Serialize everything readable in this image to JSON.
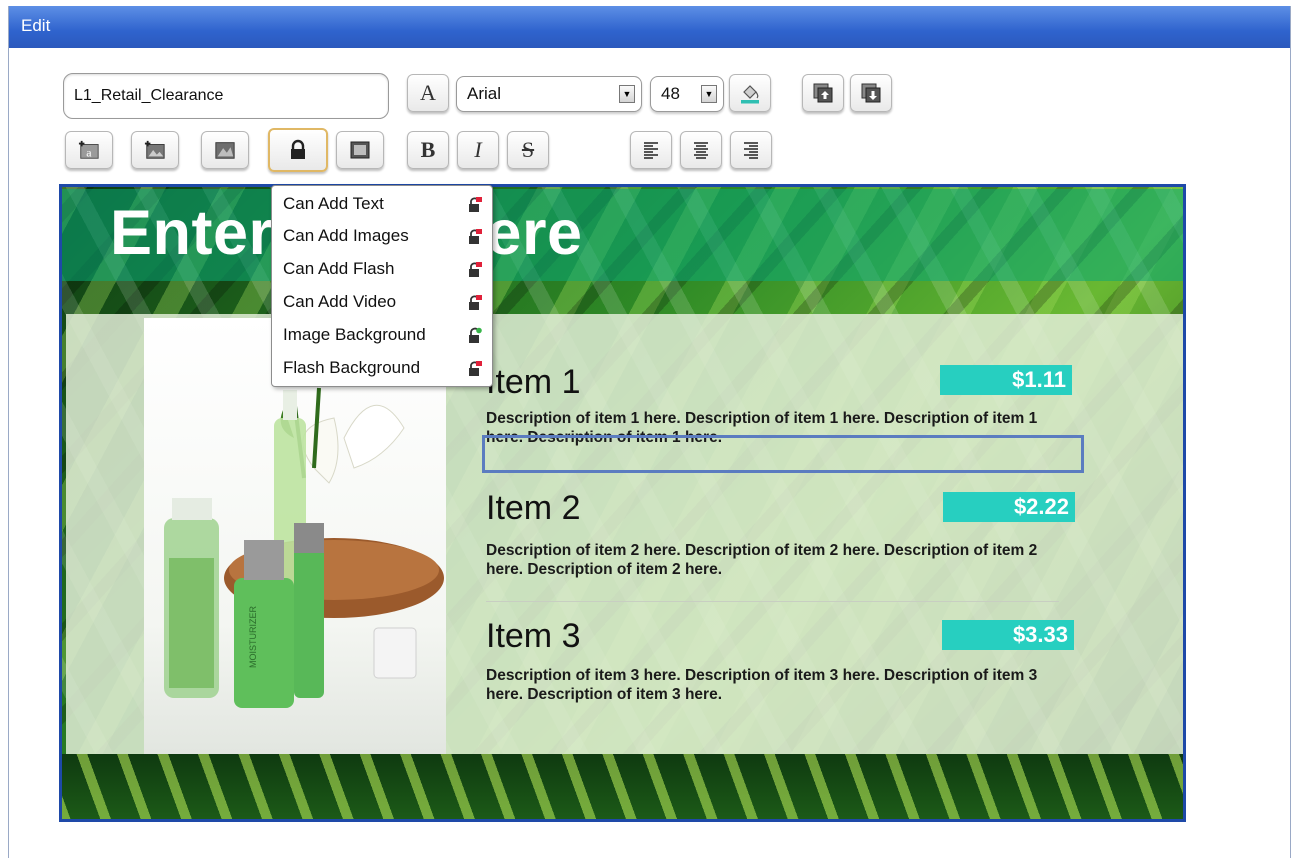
{
  "window": {
    "title": "Edit"
  },
  "toolbar": {
    "name_value": "L1_Retail_Clearance",
    "font_style_label": "A",
    "font_family": "Arial",
    "font_size": "48",
    "bold_label": "B",
    "italic_label": "I",
    "strike_label": "S",
    "add_text_label": "a"
  },
  "lock_menu": {
    "items": [
      {
        "label": "Can Add Text",
        "state": "locked"
      },
      {
        "label": "Can Add Images",
        "state": "locked"
      },
      {
        "label": "Can Add Flash",
        "state": "locked"
      },
      {
        "label": "Can Add Video",
        "state": "locked"
      },
      {
        "label": "Image Background",
        "state": "unlocked"
      },
      {
        "label": "Flash Background",
        "state": "locked"
      }
    ]
  },
  "slide": {
    "title": "Enter Title Here",
    "bottle_label": "MOISTURIZER",
    "items": [
      {
        "name": "Item 1",
        "price": "$1.11",
        "description": "Description of item 1 here. Description of item 1 here. Description of item 1 here. Description of item 1 here."
      },
      {
        "name": "Item 2",
        "price": "$2.22",
        "description": "Description of item 2 here. Description of item 2 here. Description of item 2 here. Description of item 2 here."
      },
      {
        "name": "Item 3",
        "price": "$3.33",
        "description": "Description of item 3 here. Description of item 3 here. Description of item 3 here. Description of item 3 here."
      }
    ]
  },
  "colors": {
    "titlebar": "#2f63cd",
    "canvas_border": "#1e49a8",
    "price_badge": "#27cfc0",
    "lock_locked": "#e0213a",
    "lock_unlocked": "#38b54a",
    "fill_color_swatch": "#2fbfb2"
  }
}
